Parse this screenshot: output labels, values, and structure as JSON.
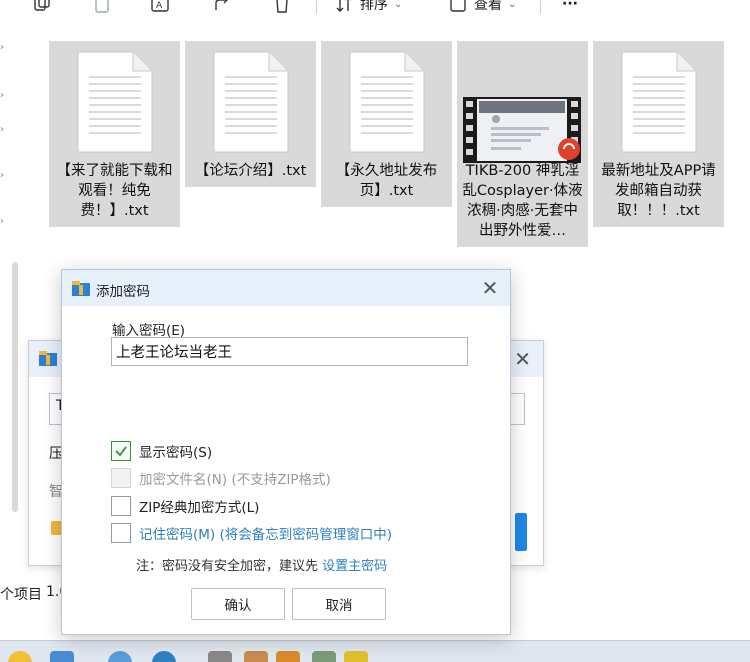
{
  "toolbar": {
    "sort_label": "排序",
    "view_label": "查看",
    "more_label": "···"
  },
  "files": [
    {
      "name": "【来了就能下载和观看！纯免费！】.txt",
      "icon": "text-file-icon"
    },
    {
      "name": "【论坛介绍】.txt",
      "icon": "text-file-icon"
    },
    {
      "name": "【永久地址发布页】.txt",
      "icon": "text-file-icon"
    },
    {
      "name": "TIKB-200 神乳淫乱Cosplayer·体液浓稠·肉感·无套中出野外性爱…",
      "icon": "video-file-icon"
    },
    {
      "name": "最新地址及APP请发邮箱自动获取！！！.txt",
      "icon": "text-file-icon"
    }
  ],
  "background_dialog": {
    "input_fragment": "T",
    "label_fragment_1": "压",
    "label_fragment_2": "智"
  },
  "statusbar": {
    "items_text": "个项目",
    "size_fragment": "1.0"
  },
  "dialog": {
    "title": "添加密码",
    "password_label": "输入密码(E)",
    "password_value": "上老王论坛当老王",
    "options": [
      {
        "label": "显示密码(S)",
        "checked": true,
        "disabled": false
      },
      {
        "label": "加密文件名(N) (不支持ZIP格式)",
        "checked": false,
        "disabled": true
      },
      {
        "label": "ZIP经典加密方式(L)",
        "checked": false,
        "disabled": false
      },
      {
        "label": "记住密码(M) (将会备忘到密码管理窗口中)",
        "checked": false,
        "disabled": false
      }
    ],
    "note_prefix": "注：密码没有安全加密，建议先 ",
    "note_link": "设置主密码",
    "ok_label": "确认",
    "cancel_label": "取消"
  },
  "colors": {
    "accent_blue": "#2d7fc1",
    "check_green": "#3b8f3b",
    "title_bar": "#e6f0fb",
    "tile_selected": "#d9d9d9"
  }
}
